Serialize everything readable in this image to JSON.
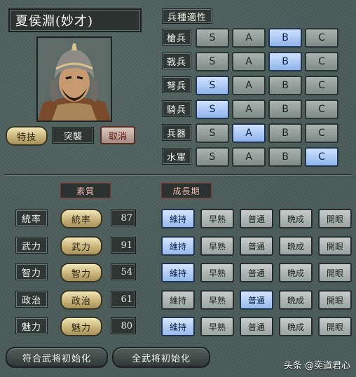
{
  "character": {
    "name": "夏侯淵(妙才)",
    "skill_label": "特技",
    "skill_value": "突襲",
    "cancel_label": "取消"
  },
  "aptitude": {
    "title": "兵種適性",
    "levels": [
      "S",
      "A",
      "B",
      "C"
    ],
    "rows": [
      {
        "label": "槍兵",
        "selected": "B"
      },
      {
        "label": "戟兵",
        "selected": "B"
      },
      {
        "label": "弩兵",
        "selected": "S"
      },
      {
        "label": "騎兵",
        "selected": "S"
      },
      {
        "label": "兵器",
        "selected": "A"
      },
      {
        "label": "水軍",
        "selected": "C"
      }
    ]
  },
  "stats": {
    "header_quality": "素質",
    "header_growth": "成長期",
    "growth_options": [
      "維持",
      "早熟",
      "普通",
      "晩成",
      "開眼"
    ],
    "rows": [
      {
        "label": "統率",
        "button": "統率",
        "value": "87",
        "growth": "維持"
      },
      {
        "label": "武力",
        "button": "武力",
        "value": "91",
        "growth": "維持"
      },
      {
        "label": "智力",
        "button": "智力",
        "value": "54",
        "growth": "維持"
      },
      {
        "label": "政治",
        "button": "政治",
        "value": "61",
        "growth": "普通"
      },
      {
        "label": "魅力",
        "button": "魅力",
        "value": "80",
        "growth": "維持"
      }
    ]
  },
  "footer": {
    "reset_matching_label": "符合武将初始化",
    "reset_all_label": "全武将初始化"
  },
  "watermark": "头条 @奕道君心",
  "colors": {
    "panel_bg": "#4b5d5a",
    "selected_blue": "#8fb4ea",
    "gold_button": "#c9b57a",
    "red_accent": "#8a2f2a"
  }
}
